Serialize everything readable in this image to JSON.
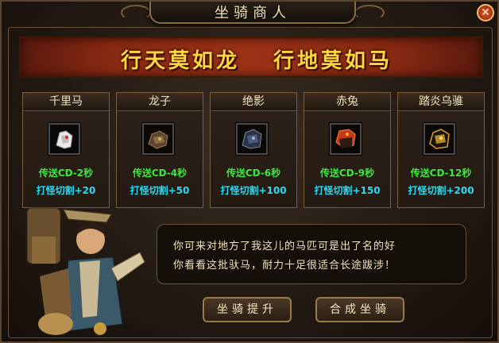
{
  "window": {
    "title": "坐骑商人",
    "close_icon": "close-icon"
  },
  "banner": {
    "left": "行天莫如龙",
    "right": "行地莫如马"
  },
  "mounts": [
    {
      "name": "千里马",
      "cd": "传送CD-2秒",
      "cut": "打怪切割+20",
      "icon": "white-horse-armor-icon"
    },
    {
      "name": "龙子",
      "cd": "传送CD-4秒",
      "cut": "打怪切割+50",
      "icon": "bronze-horse-armor-icon"
    },
    {
      "name": "绝影",
      "cd": "传送CD-6秒",
      "cut": "打怪切割+100",
      "icon": "dark-blue-horse-armor-icon"
    },
    {
      "name": "赤兔",
      "cd": "传送CD-9秒",
      "cut": "打怪切割+150",
      "icon": "red-horse-armor-icon"
    },
    {
      "name": "踏炎乌骓",
      "cd": "传送CD-12秒",
      "cut": "打怪切割+200",
      "icon": "gold-black-horse-armor-icon"
    }
  ],
  "dialog": {
    "line1": "你可来对地方了我这儿的马匹可是出了名的好",
    "line2": "你看看这批驮马，耐力十足很适合长途跋涉！"
  },
  "buttons": {
    "upgrade": "坐骑提升",
    "compose": "合成坐骑"
  },
  "colors": {
    "cd_text": "#3ee640",
    "cut_text": "#2fd8f0",
    "banner_text": "#ffd640",
    "banner_bg": "#8a2a12"
  }
}
